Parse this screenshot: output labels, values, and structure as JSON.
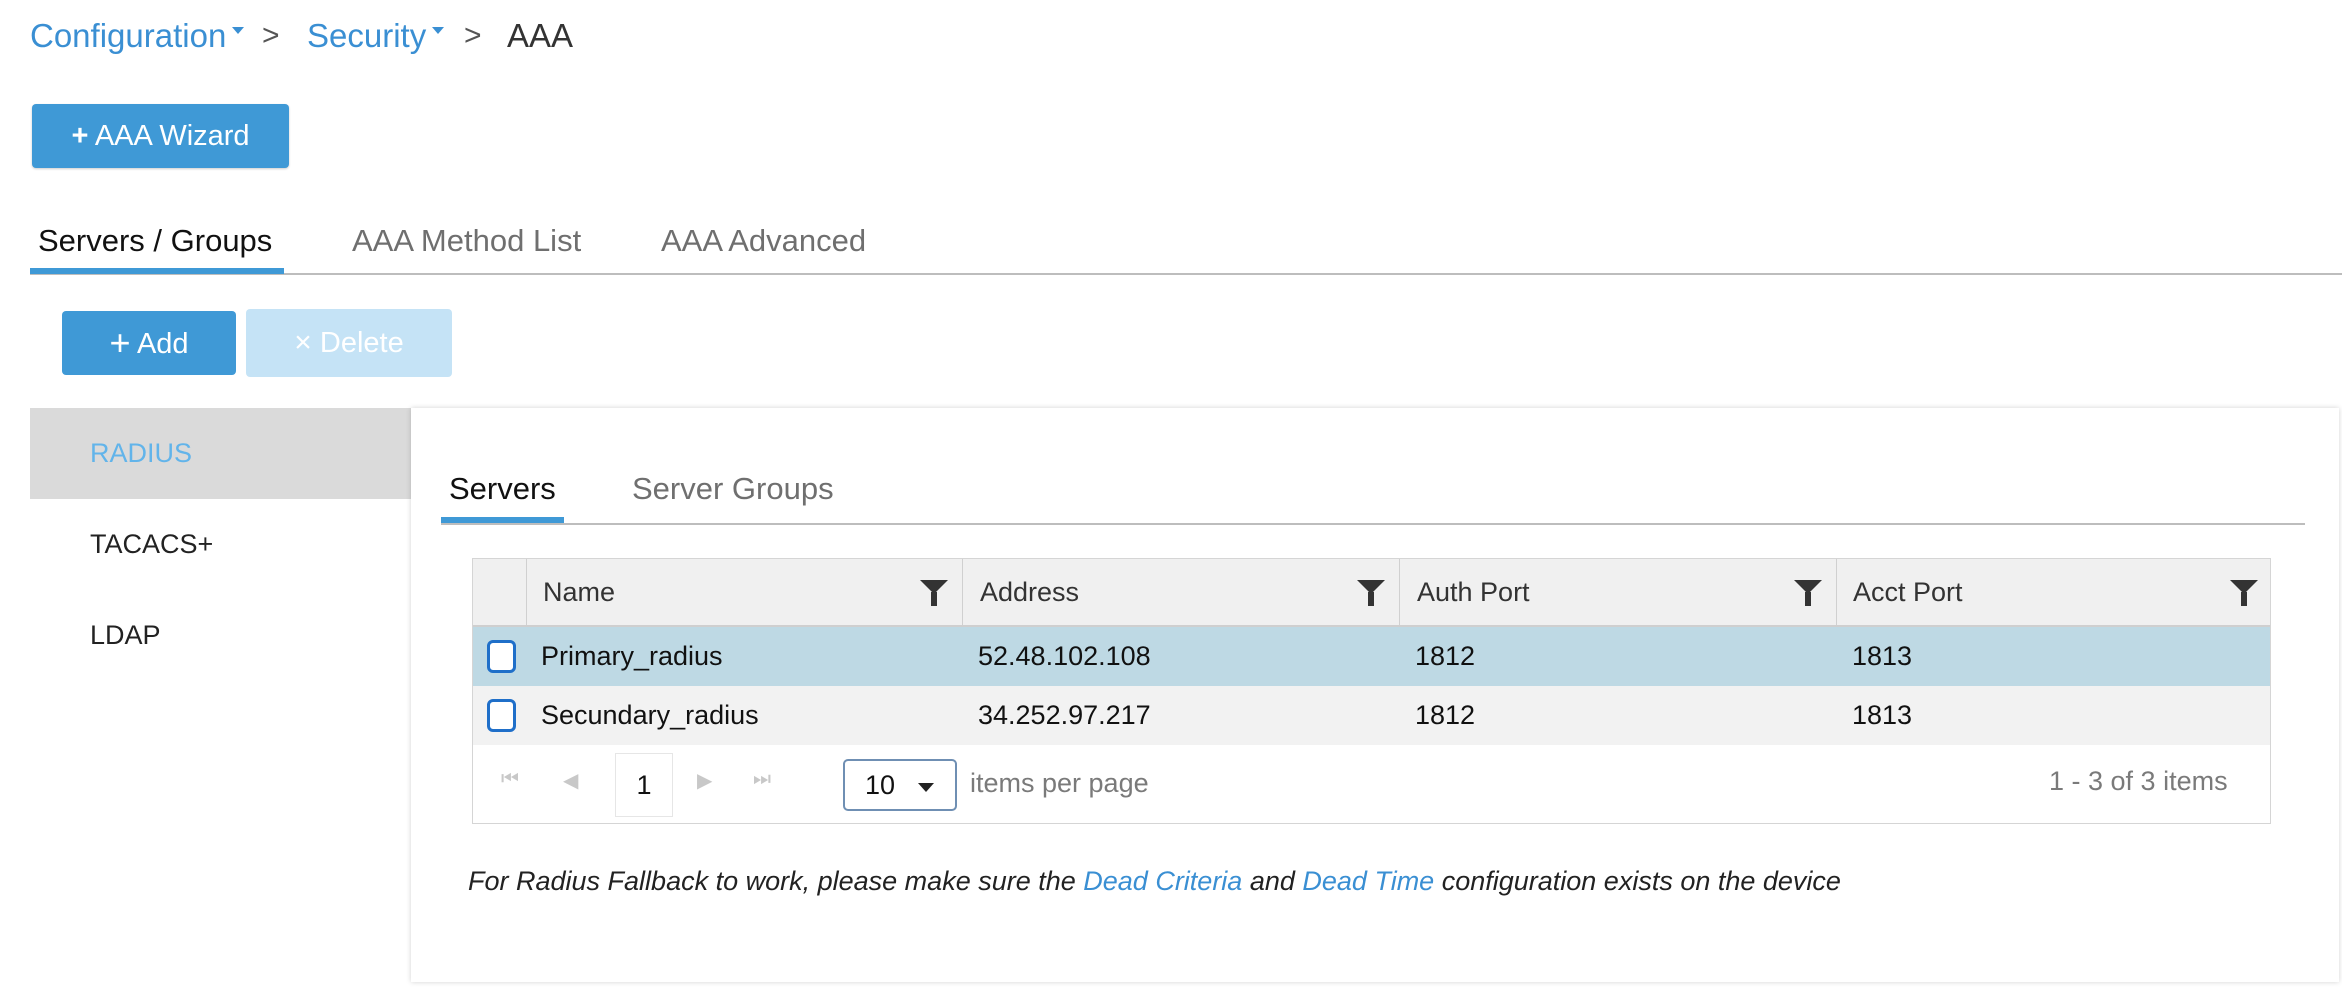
{
  "breadcrumb": {
    "items": [
      {
        "label": "Configuration"
      },
      {
        "label": "Security"
      },
      {
        "label": "AAA"
      }
    ],
    "separator": ">"
  },
  "wizard_button": {
    "icon": "plus-icon",
    "label": "AAA Wizard"
  },
  "tabs": [
    {
      "label": "Servers / Groups",
      "active": true
    },
    {
      "label": "AAA Method List",
      "active": false
    },
    {
      "label": "AAA Advanced",
      "active": false
    }
  ],
  "actions": {
    "add": {
      "icon": "plus-icon",
      "label": "Add"
    },
    "delete": {
      "icon": "close-icon",
      "label": "Delete",
      "disabled": true
    }
  },
  "server_types": [
    {
      "label": "RADIUS",
      "active": true
    },
    {
      "label": "TACACS+",
      "active": false
    },
    {
      "label": "LDAP",
      "active": false
    }
  ],
  "subtabs": [
    {
      "label": "Servers",
      "active": true
    },
    {
      "label": "Server Groups",
      "active": false
    }
  ],
  "table": {
    "columns": [
      "Name",
      "Address",
      "Auth Port",
      "Acct Port"
    ],
    "rows": [
      {
        "name": "Primary_radius",
        "address": "52.48.102.108",
        "auth_port": "1812",
        "acct_port": "1813",
        "selected": true
      },
      {
        "name": "Secundary_radius",
        "address": "34.252.97.217",
        "auth_port": "1812",
        "acct_port": "1813",
        "selected": false
      }
    ]
  },
  "pager": {
    "current_page": "1",
    "items_per_page": "10",
    "items_per_page_label": "items per page",
    "summary": "1 - 3 of 3 items"
  },
  "note": {
    "part1": "For Radius Fallback to work, please make sure the ",
    "link1": "Dead Criteria",
    "part2": " and ",
    "link2": "Dead Time",
    "part3": " configuration exists on the device"
  },
  "colors": {
    "accent": "#3f99d6",
    "link": "#3a8fd3",
    "selected_row": "#bed9e4",
    "active_nav_bg": "#dadada",
    "active_nav_text": "#62b4ea"
  }
}
